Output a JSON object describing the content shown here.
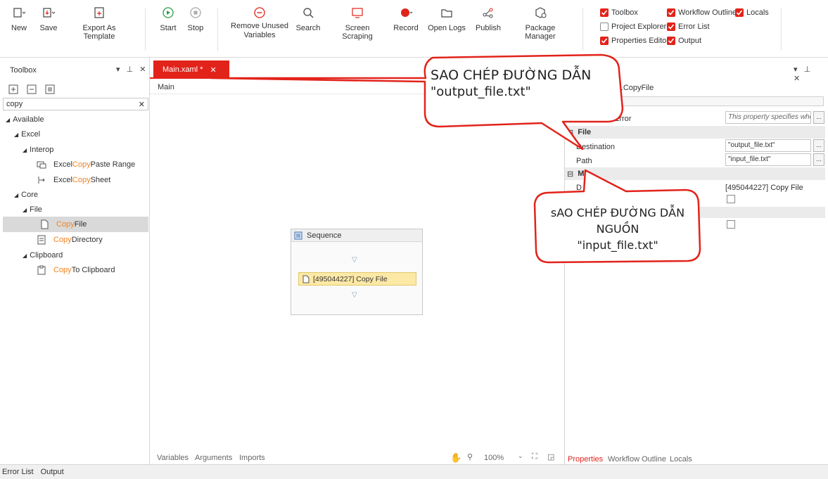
{
  "ribbon": {
    "buttons": {
      "new": "New",
      "save": "Save",
      "export_template": "Export As Template",
      "start": "Start",
      "stop": "Stop",
      "remove_unused_1": "Remove Unused",
      "remove_unused_2": "Variables",
      "search": "Search",
      "screen_scraping": "Screen Scraping",
      "record": "Record",
      "open_logs": "Open Logs",
      "publish": "Publish",
      "package_manager": "Package Manager"
    },
    "checkboxes": {
      "toolbox": "Toolbox",
      "workflow_outline": "Workflow Outline",
      "locals": "Locals",
      "project_explorer": "Project Explorer",
      "error_list": "Error List",
      "properties_editor": "Properties Editor",
      "output": "Output"
    },
    "accent": "#e2231a"
  },
  "toolbox": {
    "title": "Toolbox",
    "search_value": "copy",
    "tree": {
      "available": "Available",
      "excel": "Excel",
      "interop": "Interop",
      "excel_copy_paste_pre": "Excel ",
      "excel_copy_paste_hl": "Copy",
      "excel_copy_paste_post": " Paste Range",
      "excel_copy_sheet_pre": "Excel ",
      "excel_copy_sheet_hl": "Copy",
      "excel_copy_sheet_post": " Sheet",
      "core": "Core",
      "file": "File",
      "copy_file_hl": "Copy",
      "copy_file_post": " File",
      "copy_directory_hl": "Copy",
      "copy_directory_post": " Directory",
      "clipboard": "Clipboard",
      "copy_clipboard_hl": "Copy",
      "copy_clipboard_post": " To Clipboard"
    }
  },
  "designer": {
    "tab_label": "Main.xaml *",
    "breadcrumb": "Main",
    "sequence_title": "Sequence",
    "activity_label": "[495044227] Copy File",
    "footer": {
      "variables": "Variables",
      "arguments": "Arguments",
      "imports": "Imports",
      "zoom": "100%"
    }
  },
  "properties": {
    "activity_type": "re.CopyFile",
    "continue_on_error_label": "Error",
    "continue_on_error_value": "This property specifies whe",
    "category_file": "File",
    "destination_label": "Destination",
    "destination_value": "\"output_file.txt\"",
    "path_label": "Path",
    "path_value": "\"input_file.txt\"",
    "category_misc": "M",
    "display_name_label": "D",
    "display_name_value": "[495044227] Copy File",
    "tabs": {
      "properties": "Properties",
      "workflow_outline": "Workflow Outline",
      "locals": "Locals"
    }
  },
  "statusbar": {
    "error_list": "Error List",
    "output": "Output"
  },
  "callouts": {
    "top_line1": "SAO CHÉP ĐƯỜNG DẪN",
    "top_line2": "\"output_file.txt\"",
    "bottom_line1": "sAO CHÉP ĐƯỜNG DẪN",
    "bottom_line2": "NGUỒN",
    "bottom_line3": "\"input_file.txt\"",
    "border_color": "#e2231a"
  }
}
